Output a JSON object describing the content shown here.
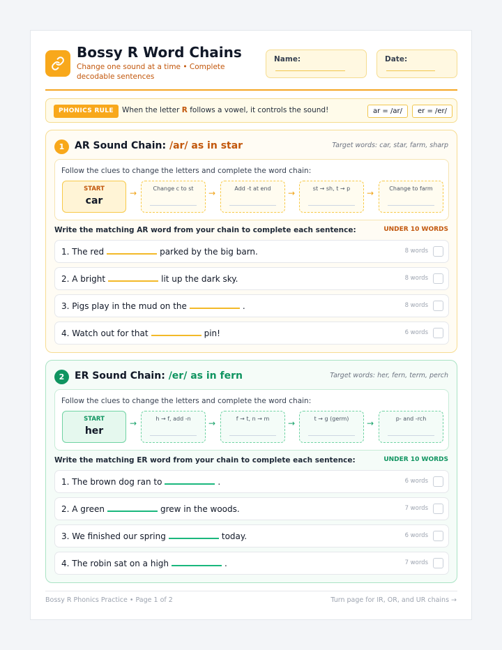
{
  "header": {
    "title": "Bossy R Word Chains",
    "subtitle": "Change one sound at a time • Complete decodable sentences",
    "name_label": "Name:",
    "date_label": "Date:",
    "logo_icon": "link-icon"
  },
  "rule": {
    "badge": "PHONICS RULE",
    "text_before": "When the letter ",
    "letter": "R",
    "text_after": " follows a vowel, it controls the sound!",
    "pill_ar": "ar = /ar/",
    "pill_er": "er = /er/"
  },
  "sections": [
    {
      "number": "1",
      "title_main": "AR Sound Chain:",
      "title_accent": "/ar/ as in star",
      "target": "Target words: car, star, farm, sharp",
      "chain_instruction": "Follow the clues to change the letters and complete the word chain:",
      "start_label": "START",
      "start_word": "car",
      "steps": [
        "Change c to st",
        "Add -t at end",
        "st → sh, t → p",
        "Change to farm"
      ],
      "write_instruction": "Write the matching AR word from your chain to complete each sentence:",
      "limit": "UNDER 10 WORDS",
      "sentences": [
        {
          "before": "1. The red",
          "after": "parked by the big barn.",
          "count": "8 words"
        },
        {
          "before": "2. A bright",
          "after": "lit up the dark sky.",
          "count": "8 words"
        },
        {
          "before": "3. Pigs play in the mud on the",
          "after": ".",
          "count": "8 words"
        },
        {
          "before": "4. Watch out for that",
          "after": "pin!",
          "count": "6 words"
        }
      ]
    },
    {
      "number": "2",
      "title_main": "ER Sound Chain:",
      "title_accent": "/er/ as in fern",
      "target": "Target words: her, fern, term, perch",
      "chain_instruction": "Follow the clues to change the letters and complete the word chain:",
      "start_label": "START",
      "start_word": "her",
      "steps": [
        "h → f, add -n",
        "f → t, n → m",
        "t → g (germ)",
        "p- and -rch"
      ],
      "write_instruction": "Write the matching ER word from your chain to complete each sentence:",
      "limit": "UNDER 10 WORDS",
      "sentences": [
        {
          "before": "1. The brown dog ran to",
          "after": ".",
          "count": "6 words"
        },
        {
          "before": "2. A green",
          "after": "grew in the woods.",
          "count": "7 words"
        },
        {
          "before": "3. We finished our spring",
          "after": "today.",
          "count": "6 words"
        },
        {
          "before": "4. The robin sat on a high",
          "after": ".",
          "count": "7 words"
        }
      ]
    }
  ],
  "footer": {
    "left": "Bossy R Phonics Practice • Page 1 of 2",
    "right": "Turn page for IR, OR, and UR chains →"
  },
  "colors": {
    "orange_accent": "#f8a81b",
    "ar_text": "#c2570c",
    "er_accent": "#0f9460"
  }
}
